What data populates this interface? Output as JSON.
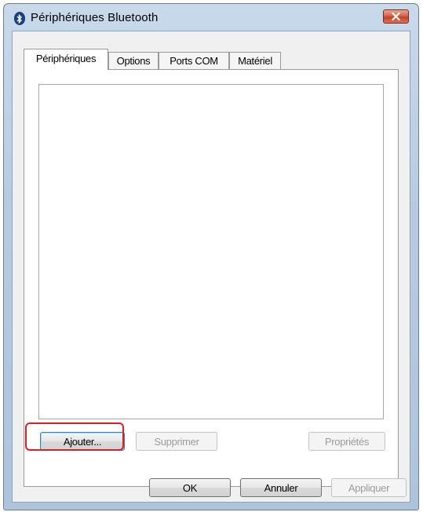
{
  "window": {
    "title": "Périphériques Bluetooth",
    "icon": "bluetooth-icon",
    "close_icon": "close-icon"
  },
  "tabs": [
    {
      "label": "Périphériques",
      "active": true
    },
    {
      "label": "Options",
      "active": false
    },
    {
      "label": "Ports COM",
      "active": false
    },
    {
      "label": "Matériel",
      "active": false
    }
  ],
  "device_list": {
    "items": []
  },
  "panel_buttons": {
    "add": "Ajouter...",
    "remove": "Supprimer",
    "properties": "Propriétés"
  },
  "dialog_buttons": {
    "ok": "OK",
    "cancel": "Annuler",
    "apply": "Appliquer"
  },
  "colors": {
    "highlight": "#d8202a",
    "titlebar": "#b7cbe0",
    "close_button": "#c1432a"
  }
}
